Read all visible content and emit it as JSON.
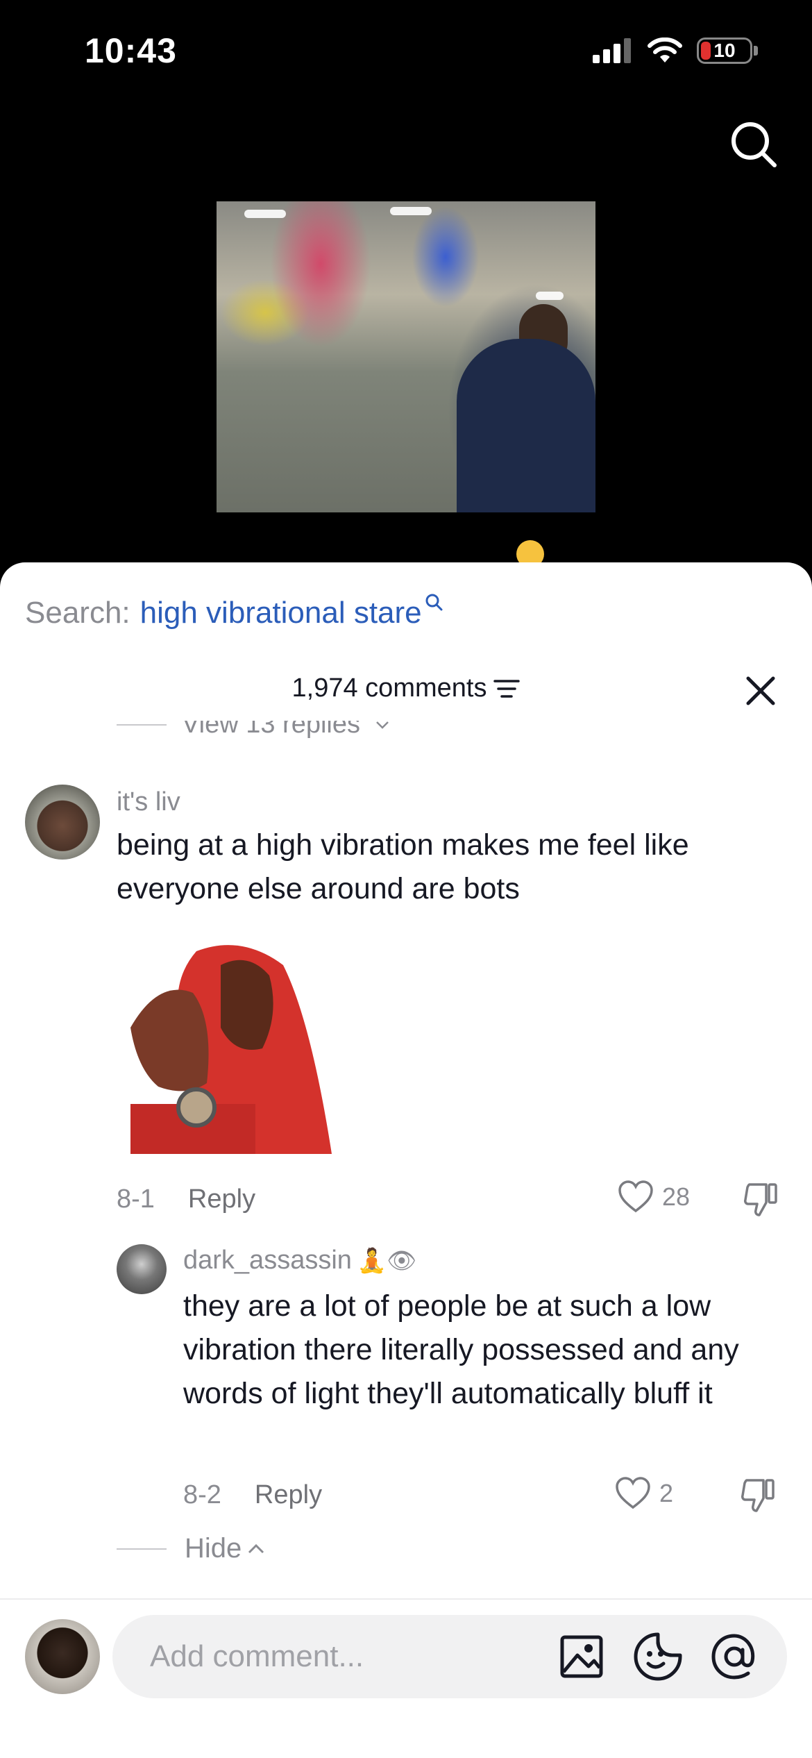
{
  "status_bar": {
    "time": "10:43",
    "battery": "10"
  },
  "sheet": {
    "search_label": "Search:",
    "search_keyword": "high vibrational stare",
    "comment_count": "1,974 comments",
    "view_replies": "View 13 replies"
  },
  "comments": [
    {
      "username": "it's liv",
      "text": "being at a high vibration makes me feel like everyone else around are bots",
      "date": "8-1",
      "reply_label": "Reply",
      "likes": "28"
    },
    {
      "username": "dark_assassin",
      "username_emojis": "🧘👁",
      "text": "they are a lot of people be at such a low vibration there literally possessed and any words of light they'll automatically bluff it",
      "date": "8-2",
      "reply_label": "Reply",
      "likes": "2"
    }
  ],
  "hide_label": "Hide",
  "composer": {
    "placeholder": "Add comment..."
  },
  "colors": {
    "keyword_blue": "#2b5db9",
    "meta_gray": "#8a8b91",
    "battery_red": "#e0312f"
  },
  "icons": [
    "search-icon",
    "sort-icon",
    "close-icon",
    "heart-icon",
    "dislike-icon",
    "image-icon",
    "sticker-icon",
    "mention-icon"
  ]
}
